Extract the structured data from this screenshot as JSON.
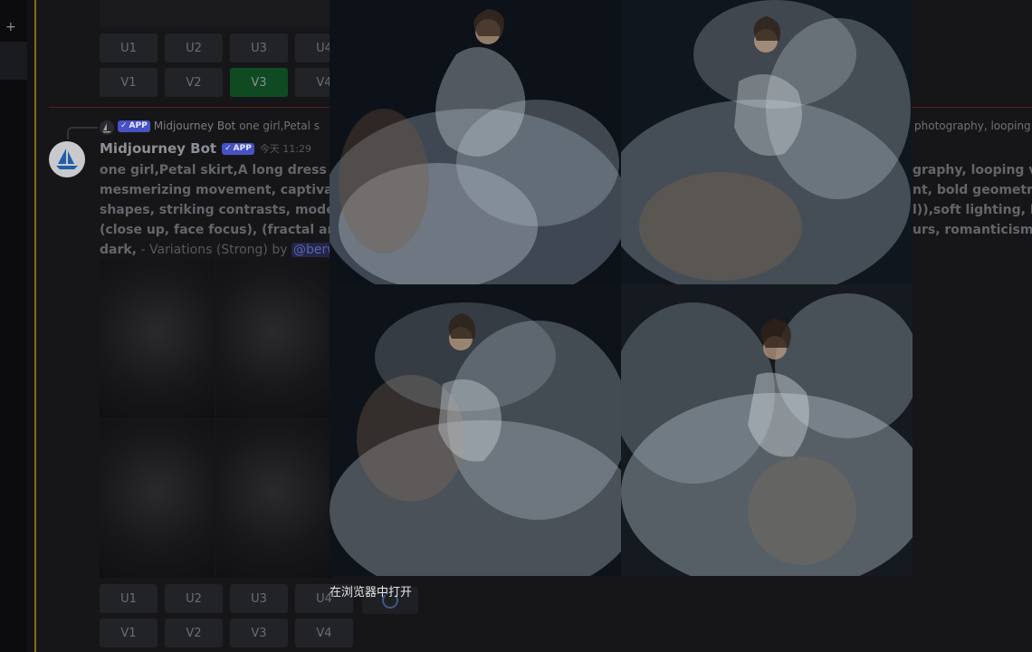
{
  "rail": {
    "add_icon": "+"
  },
  "top_buttons": {
    "row1": [
      "U1",
      "U2",
      "U3",
      "U4"
    ],
    "row2": [
      "V1",
      "V2",
      "V3",
      "V4"
    ],
    "active": "V3"
  },
  "reply": {
    "author": "Midjourney Bot",
    "badge": "APP",
    "snippet_left": "one girl,Petal s",
    "snippet_right": "photography, looping"
  },
  "message": {
    "author": "Midjourney Bot",
    "badge": "APP",
    "timestamp": "今天 11:29",
    "lines_left": [
      "one girl,Petal skirt,A long dress hem",
      "mesmerizing movement, captivating",
      "shapes, striking contrasts, modernis",
      "(close up, face focus), (fractal art) e"
    ],
    "lines_right": [
      "graphy, looping vide",
      "nt, bold geometry, f",
      "l)),soft lighting, Hap",
      "urs, romanticism,d"
    ],
    "last_line_bold": "dark,",
    "last_line_rest": " - Variations (Strong) by ",
    "mention": "@berwa"
  },
  "bottom_buttons": {
    "row1": [
      "U1",
      "U2",
      "U3",
      "U4"
    ],
    "row2": [
      "V1",
      "V2",
      "V3",
      "V4"
    ]
  },
  "viewer": {
    "open_in_browser": "在浏览器中打开"
  },
  "colors": {
    "accent_green": "#0f4a23",
    "app_badge": "#4752c4",
    "unread_divider": "#5a1f1f"
  }
}
